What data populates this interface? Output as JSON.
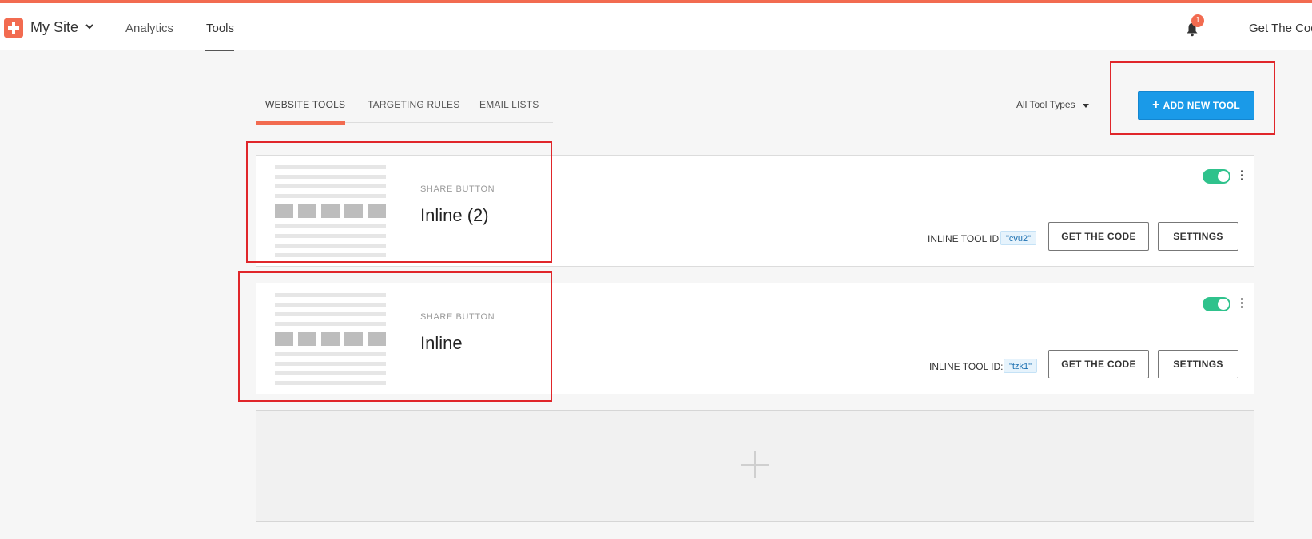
{
  "header": {
    "site_name": "My Site",
    "nav": [
      {
        "label": "Analytics"
      },
      {
        "label": "Tools",
        "active": true
      }
    ],
    "notification_count": "1",
    "get_code_link": "Get The Cod"
  },
  "tabs": [
    {
      "label": "WEBSITE TOOLS",
      "active": true
    },
    {
      "label": "TARGETING RULES"
    },
    {
      "label": "EMAIL LISTS"
    }
  ],
  "filter": {
    "label": "All Tool Types"
  },
  "add_tool_button": "ADD NEW TOOL",
  "tools": [
    {
      "type": "SHARE BUTTON",
      "name": "Inline (2)",
      "enabled": true,
      "id_label": "INLINE TOOL ID:",
      "id": "\"cvu2\"",
      "get_code_label": "GET THE CODE",
      "settings_label": "SETTINGS"
    },
    {
      "type": "SHARE BUTTON",
      "name": "Inline",
      "enabled": true,
      "id_label": "INLINE TOOL ID:",
      "id": "\"tzk1\"",
      "get_code_label": "GET THE CODE",
      "settings_label": "SETTINGS"
    }
  ],
  "colors": {
    "accent": "#f26b50",
    "primary_button": "#1a9ae8",
    "toggle_on": "#2fc28c",
    "annotation": "#e0262a"
  }
}
